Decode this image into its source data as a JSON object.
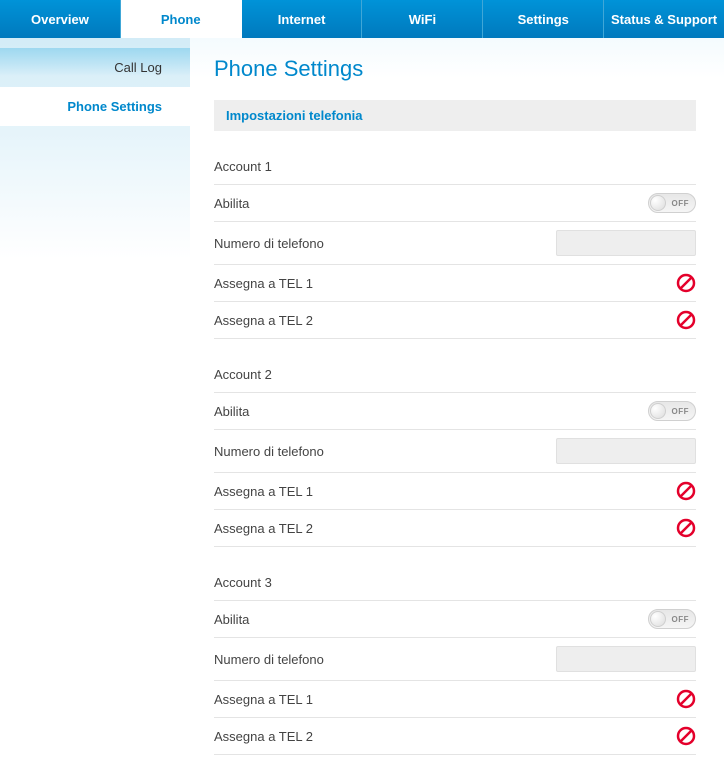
{
  "topnav": {
    "tabs": [
      {
        "label": "Overview"
      },
      {
        "label": "Phone"
      },
      {
        "label": "Internet"
      },
      {
        "label": "WiFi"
      },
      {
        "label": "Settings"
      },
      {
        "label": "Status & Support"
      }
    ],
    "active_index": 1
  },
  "sidebar": {
    "items": [
      {
        "label": "Call Log"
      },
      {
        "label": "Phone Settings"
      }
    ],
    "active_index": 1
  },
  "page": {
    "title": "Phone Settings",
    "section_header": "Impostazioni telefonia"
  },
  "labels": {
    "account_prefix": "Account",
    "enable": "Abilita",
    "phone_number": "Numero di telefono",
    "assign_tel1": "Assegna a TEL 1",
    "assign_tel2": "Assegna a TEL 2",
    "toggle_off": "OFF"
  },
  "accounts": [
    {
      "index": 1,
      "title": "Account 1",
      "enabled": false,
      "phone_number": "",
      "tel1_allowed": false,
      "tel2_allowed": false
    },
    {
      "index": 2,
      "title": "Account 2",
      "enabled": false,
      "phone_number": "",
      "tel1_allowed": false,
      "tel2_allowed": false
    },
    {
      "index": 3,
      "title": "Account 3",
      "enabled": false,
      "phone_number": "",
      "tel1_allowed": false,
      "tel2_allowed": false
    }
  ],
  "colors": {
    "primary": "#0088cc",
    "forbid": "#e4002b"
  }
}
